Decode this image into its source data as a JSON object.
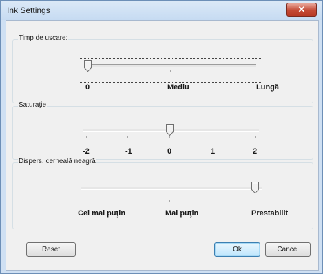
{
  "window": {
    "title": "Ink Settings",
    "close_glyph": "✕"
  },
  "groups": {
    "drying_time": {
      "label": "Timp de uscare:",
      "labels": [
        "0",
        "Mediu",
        "Lungă"
      ],
      "selected_index": 0,
      "steps": 3
    },
    "saturation": {
      "label": "Saturaţie",
      "labels": [
        "-2",
        "-1",
        "0",
        "1",
        "2"
      ],
      "selected_index": 2,
      "steps": 5
    },
    "black_ink_spread": {
      "label": "Dispers. cerneală neagră",
      "labels": [
        "Cel mai puţin",
        "Mai puţin",
        "Prestabilit"
      ],
      "selected_index": 2,
      "steps": 3
    }
  },
  "buttons": {
    "reset": "Reset",
    "ok": "Ok",
    "cancel": "Cancel"
  },
  "colors": {
    "title_bar": "#c6dbf2",
    "close_button": "#c44a35",
    "dialog_bg": "#f0f0f0",
    "ok_highlight": "#bee6fd"
  }
}
